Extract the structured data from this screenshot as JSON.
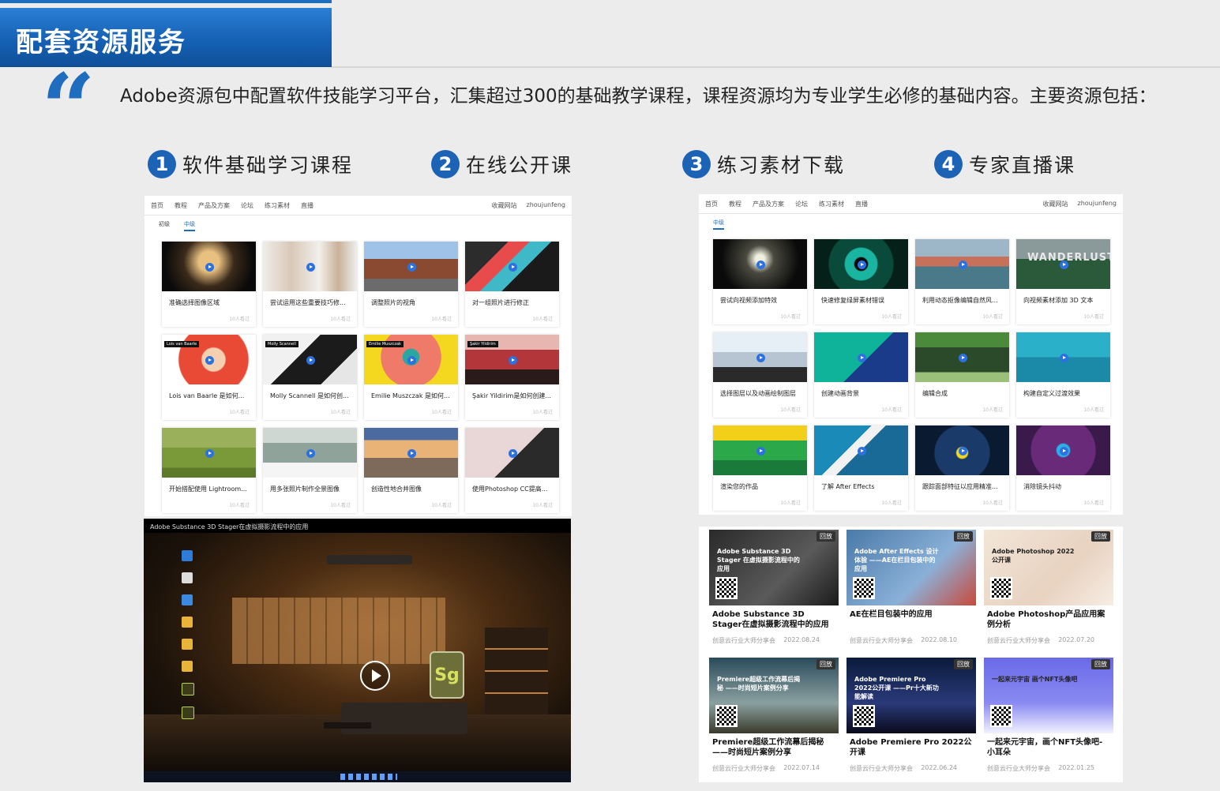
{
  "header": {
    "title": "配套资源服务"
  },
  "intro": {
    "text": "Adobe资源包中配置软件技能学习平台，汇集超过300的基础教学课程，课程资源均为专业学生必修的基础内容。主要资源包括："
  },
  "categories": [
    {
      "num": "1",
      "label": "软件基础学习课程"
    },
    {
      "num": "2",
      "label": "在线公开课"
    },
    {
      "num": "3",
      "label": "练习素材下载"
    },
    {
      "num": "4",
      "label": "专家直播课"
    }
  ],
  "left_site": {
    "nav": [
      "首页",
      "教程",
      "产品及方案",
      "论坛",
      "练习素材",
      "直播"
    ],
    "nav_right": [
      "收藏网站",
      "zhoujunfeng"
    ],
    "tabs": [
      "初级",
      "中级"
    ],
    "active_tab": "中级",
    "meta": "10人看过",
    "cards": [
      {
        "title": "准确选择图像区域"
      },
      {
        "title": "尝试运用这些重要技巧修..."
      },
      {
        "title": "调整照片的视角"
      },
      {
        "title": "对一组照片进行修正"
      },
      {
        "title": "Lois van Baarle 是如何..."
      },
      {
        "title": "Molly Scannell 是如何创..."
      },
      {
        "title": "Emilie Muszczak 是如何..."
      },
      {
        "title": "Şakir Yildirim是如何创建..."
      },
      {
        "title": "开始搭配使用 Lightroom..."
      },
      {
        "title": "用多张照片制作全景图像"
      },
      {
        "title": "创造性地合并图像"
      },
      {
        "title": "使用Photoshop CC提高..."
      }
    ],
    "overlay_labels": [
      "Lois van Baarle",
      "Molly Scannell",
      "Emilie Muszczak",
      "Şakir Yildirim"
    ]
  },
  "video": {
    "title": "Adobe Substance 3D Stager在虚拟摄影流程中的应用",
    "logo": "Sg"
  },
  "right_site": {
    "nav": [
      "首页",
      "教程",
      "产品及方案",
      "论坛",
      "练习素材",
      "直播"
    ],
    "nav_right": [
      "收藏网站",
      "zhoujunfeng"
    ],
    "tabs": [
      "中级"
    ],
    "meta": "10人看过",
    "cards": [
      {
        "title": "尝试向视频添加特效"
      },
      {
        "title": "快速修复绿屏素材错误"
      },
      {
        "title": "利用动态抠像编辑自然风..."
      },
      {
        "title": "向视频素材添加 3D 文本"
      },
      {
        "title": "选择图层以及动画绘制图层"
      },
      {
        "title": "创建动画背景"
      },
      {
        "title": "编辑合成"
      },
      {
        "title": "构建自定义过渡效果"
      },
      {
        "title": "渲染您的作品"
      },
      {
        "title": "了解 After Effects"
      },
      {
        "title": "跟踪面部特征以应用精准..."
      },
      {
        "title": "消除镜头抖动"
      }
    ],
    "wanderlust": "WANDERLUST"
  },
  "live": {
    "badge": "回放",
    "items": [
      {
        "title": "Adobe Substance 3D Stager在虚拟摄影流程中的应用",
        "host": "创意云行业大师分享会",
        "date": "2022.08.24",
        "head": "Adobe Substance 3D Stager 在虚拟摄影流程中的应用"
      },
      {
        "title": "AE在栏目包装中的应用",
        "host": "创意云行业大师分享会",
        "date": "2022.08.10",
        "head": "Adobe After Effects 设计体验 ——AE在栏目包装中的应用"
      },
      {
        "title": "Adobe Photoshop产品应用案例分析",
        "host": "创意云行业大师分享会",
        "date": "2022.07.20",
        "head": "Adobe Photoshop 2022公开课"
      },
      {
        "title": "Premiere超级工作流幕后揭秘——时尚短片案例分享",
        "host": "创意云行业大师分享会",
        "date": "2022.07.14",
        "head": "Premiere超级工作流幕后揭秘 ——时尚短片案例分享"
      },
      {
        "title": "Adobe Premiere Pro 2022公开课",
        "host": "创意云行业大师分享会",
        "date": "2022.06.24",
        "head": "Adobe Premiere Pro 2022公开课 ——Pr十大新功能解读"
      },
      {
        "title": "一起来元宇宙，画个NFT头像吧-小耳朵",
        "host": "创意云行业大师分享会",
        "date": "2022.01.25",
        "head": "一起来元宇宙 画个NFT头像吧"
      }
    ]
  },
  "colors": {
    "accent": "#1f6dbf",
    "banner": "#1561b5",
    "badge_bg": "#1c63b6"
  }
}
